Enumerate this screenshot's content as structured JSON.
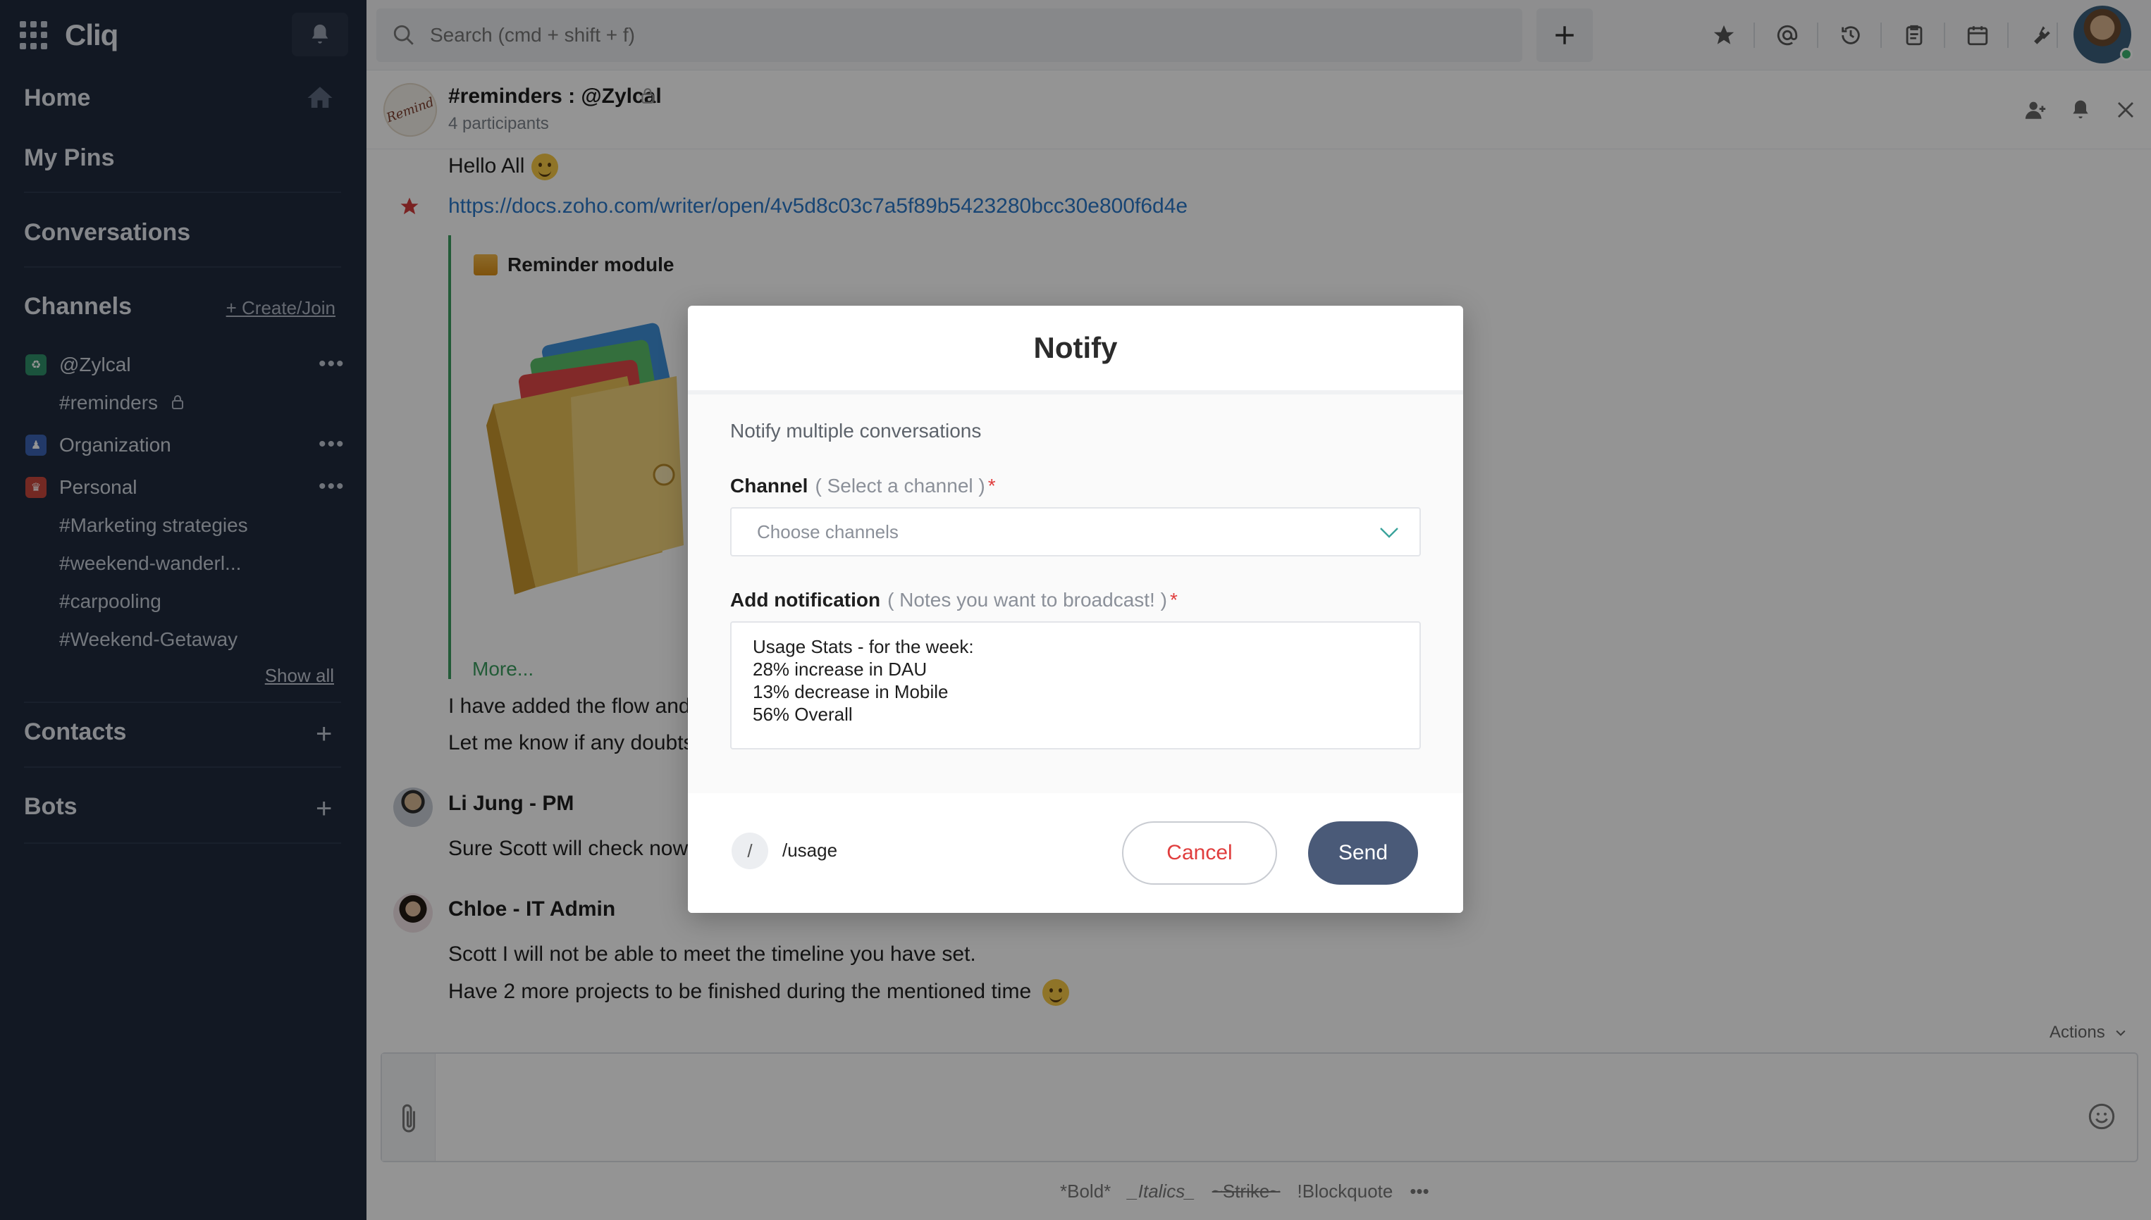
{
  "app": {
    "name": "Cliq"
  },
  "sidebar": {
    "home": "Home",
    "pins": "My Pins",
    "conversations": "Conversations",
    "channels_title": "Channels",
    "create_join": "+ Create/Join",
    "orgs": [
      {
        "name": "@Zylcal",
        "color": "#2f8f6a",
        "glyph": "♻"
      },
      {
        "name": "Organization",
        "color": "#3b63b3",
        "glyph": "♟"
      },
      {
        "name": "Personal",
        "color": "#c9473d",
        "glyph": "♛"
      }
    ],
    "zylcal_channels": [
      "#reminders"
    ],
    "personal_channels": [
      "#Marketing strategies",
      "#weekend-wanderl...",
      "#carpooling",
      "#Weekend-Getaway"
    ],
    "show_all": "Show all",
    "contacts": "Contacts",
    "bots": "Bots"
  },
  "topbar": {
    "search_placeholder": "Search (cmd + shift + f)"
  },
  "chat": {
    "title": "#reminders : @Zylcal",
    "participants": "4 participants",
    "avatar_text": "Remind",
    "messages": {
      "hello": "Hello All",
      "link": "https://docs.zoho.com/writer/open/4v5d8c03c7a5f89b5423280bcc30e800f6d4e",
      "card_title": "Reminder module",
      "card_more": "More...",
      "flow_line1": "I have added the flow and",
      "flow_line2": "Let me know if any doubts",
      "sender1": "Li Jung - PM",
      "sender1_msg": "Sure Scott will check now",
      "sender2": "Chloe - IT Admin",
      "sender2_msg1": "Scott I will not be able to meet the timeline you have set.",
      "sender2_msg2": "Have 2 more projects to be finished during the mentioned time"
    },
    "actions": "Actions",
    "format": [
      "*Bold*",
      "_Italics_",
      "~Strike~",
      "!Blockquote",
      "•••"
    ]
  },
  "modal": {
    "title": "Notify",
    "description": "Notify multiple conversations",
    "channel_label": "Channel",
    "channel_hint": "( Select a channel )",
    "required_mark": "*",
    "channel_placeholder": "Choose channels",
    "notification_label": "Add notification",
    "notification_hint": "( Notes you want to broadcast! )",
    "notification_lines": [
      "Usage Stats - for the week:",
      "28% increase in DAU",
      "13% decrease in Mobile",
      "56% Overall"
    ],
    "slash": "/",
    "command": "/usage",
    "cancel": "Cancel",
    "send": "Send"
  }
}
